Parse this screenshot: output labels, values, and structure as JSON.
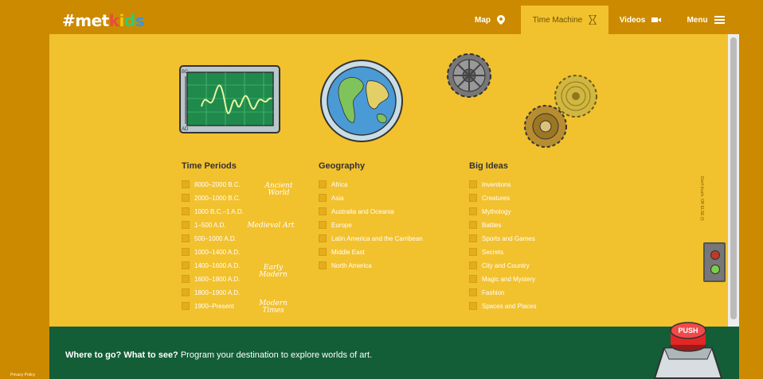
{
  "header": {
    "logo": {
      "hash": "#",
      "met": "met",
      "k": "k",
      "i": "i",
      "d": "d",
      "s": "s"
    },
    "nav": [
      {
        "label": "Map",
        "icon": "map-pin-icon"
      },
      {
        "label": "Time Machine",
        "icon": "hourglass-icon",
        "active": true
      },
      {
        "label": "Videos",
        "icon": "video-camera-icon"
      },
      {
        "label": "Menu",
        "icon": "hamburger-menu-icon"
      }
    ]
  },
  "columns": {
    "time": {
      "title": "Time Periods",
      "items": [
        "8000–2000 B.C.",
        "2000–1000 B.C.",
        "1000 B.C.–1 A.D.",
        "1–500 A.D.",
        "500–1000 A.D.",
        "1000–1400 A.D.",
        "1400–1600 A.D.",
        "1600–1800 A.D.",
        "1800–1900 A.D.",
        "1900–Present"
      ],
      "eras": [
        "Ancient World",
        "Medieval Art",
        "Early Modern",
        "Modern Times"
      ]
    },
    "geo": {
      "title": "Geography",
      "items": [
        "Africa",
        "Asia",
        "Australia and Oceania",
        "Europe",
        "Latin America and the Carribean",
        "Middle East",
        "North America"
      ]
    },
    "ideas": {
      "title": "Big Ideas",
      "items": [
        "Inventions",
        "Creatures",
        "Mythology",
        "Battles",
        "Sports and Games",
        "Secrets",
        "City and Country",
        "Magic and Mystery",
        "Fashion",
        "Spaces and Places"
      ]
    }
  },
  "side_text": "Don't touch. OR ELSE (!)",
  "bottom": {
    "tagline_bold": "Where to go? What to see?",
    "tagline_rest": "Program your destination to explore worlds of art.",
    "push_label": "PUSH"
  },
  "footer": {
    "privacy": "Privacy Policy"
  },
  "colors": {
    "background": "#cc8a00",
    "panel": "#f2c12e",
    "bottom": "#135e37",
    "push_red": "#e32626"
  }
}
